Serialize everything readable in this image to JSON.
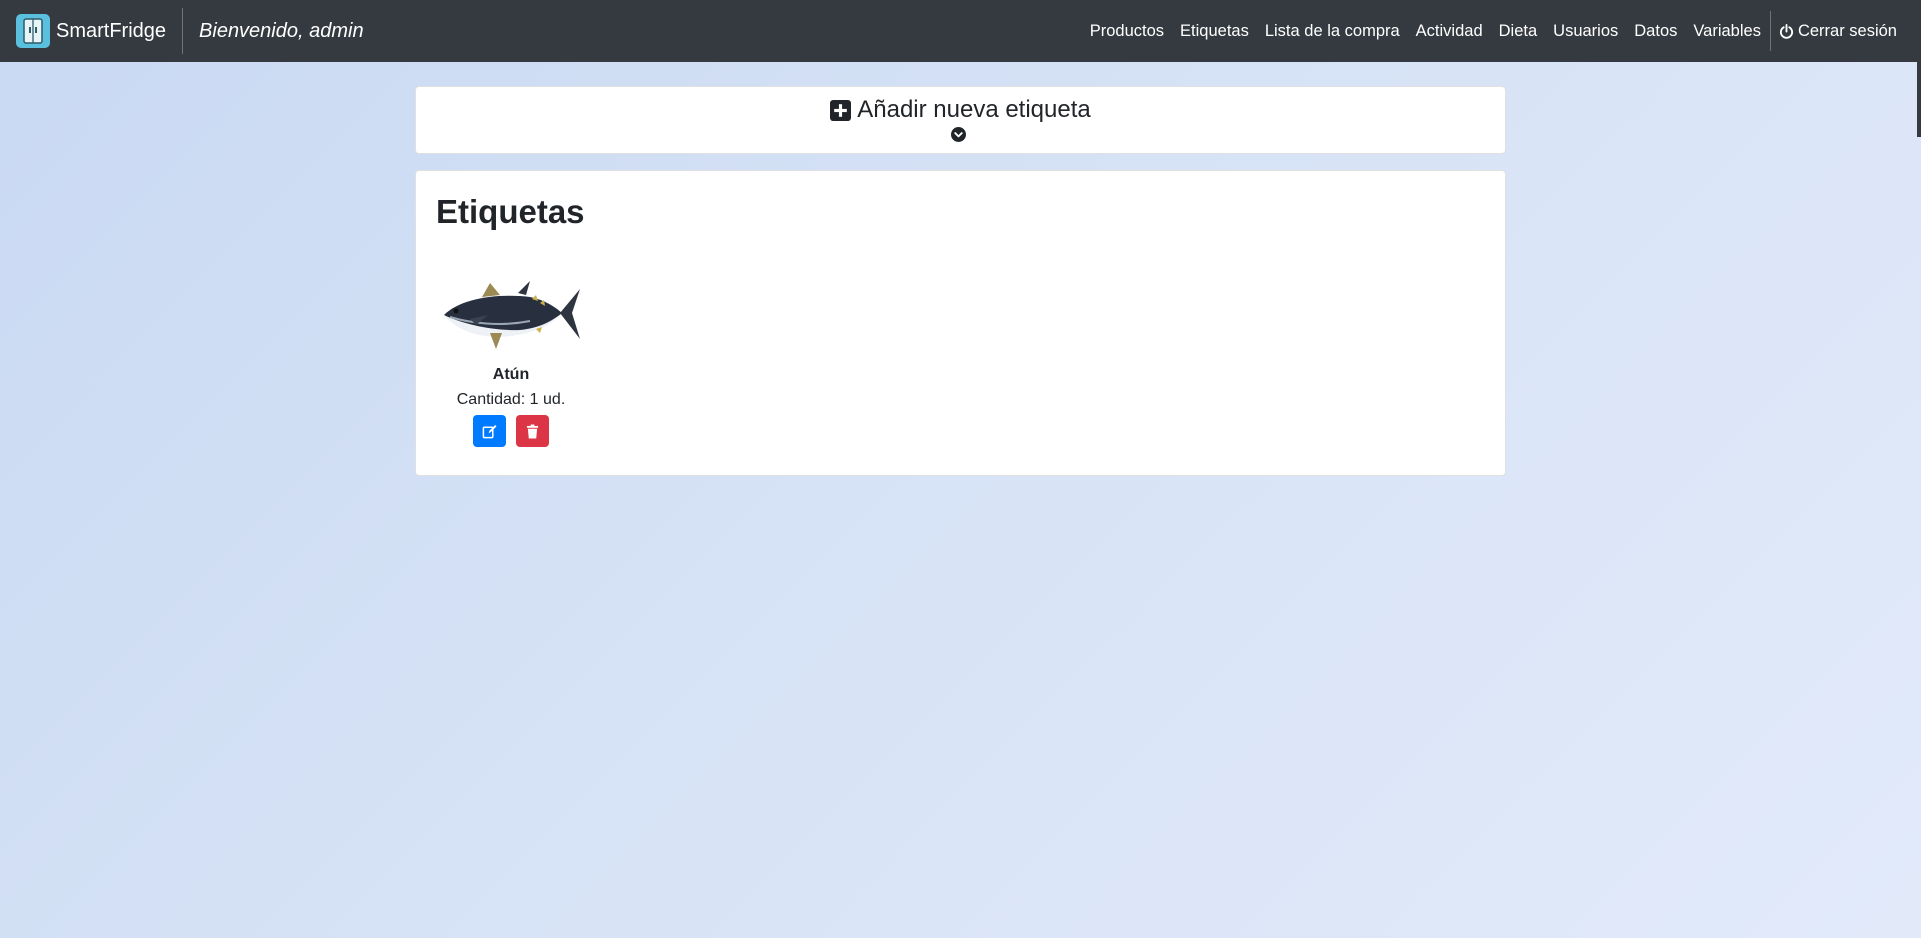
{
  "navbar": {
    "brand": "SmartFridge",
    "welcome": "Bienvenido, admin",
    "links": [
      "Productos",
      "Etiquetas",
      "Lista de la compra",
      "Actividad",
      "Dieta",
      "Usuarios",
      "Datos",
      "Variables"
    ],
    "logout": "Cerrar sesión",
    "logo_icon": "fridge-icon",
    "logout_icon": "power-icon"
  },
  "add_panel": {
    "title": "Añadir nueva etiqueta",
    "icon": "plus-square-icon",
    "toggle_icon": "chevron-down-circle-icon"
  },
  "tags_panel": {
    "title": "Etiquetas",
    "items": [
      {
        "name": "Atún",
        "quantity": "Cantidad: 1 ud.",
        "image": "tuna-fish-image",
        "edit_icon": "edit-icon",
        "delete_icon": "trash-icon"
      }
    ]
  },
  "colors": {
    "navbar": "#343a40",
    "edit_button": "#007bff",
    "delete_button": "#dc3545",
    "logo_bg": "#5bc0de"
  }
}
